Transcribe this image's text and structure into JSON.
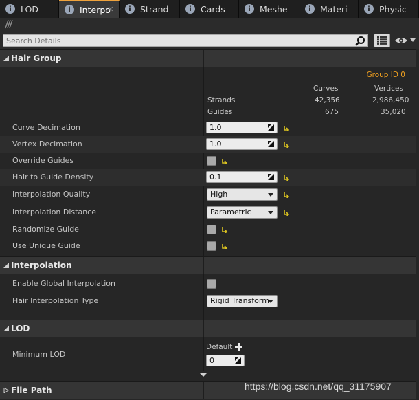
{
  "tabs": [
    {
      "label": "LOD",
      "active": false
    },
    {
      "label": "Interpo",
      "active": true
    },
    {
      "label": "Strand",
      "active": false
    },
    {
      "label": "Cards",
      "active": false
    },
    {
      "label": "Meshe",
      "active": false
    },
    {
      "label": "Materi",
      "active": false
    },
    {
      "label": "Physic",
      "active": false
    }
  ],
  "search": {
    "placeholder": "Search Details"
  },
  "hair_group": {
    "title": "Hair Group",
    "group_id": "Group ID 0",
    "col_curves": "Curves",
    "col_vertices": "Vertices",
    "rows": [
      {
        "label": "Strands",
        "curves": "42,356",
        "vertices": "2,986,450"
      },
      {
        "label": "Guides",
        "curves": "675",
        "vertices": "35,020"
      }
    ],
    "props": {
      "curve_decimation": {
        "label": "Curve Decimation",
        "value": "1.0"
      },
      "vertex_decimation": {
        "label": "Vertex Decimation",
        "value": "1.0"
      },
      "override_guides": {
        "label": "Override Guides",
        "checked": false
      },
      "hair_to_guide_density": {
        "label": "Hair to Guide Density",
        "value": "0.1"
      },
      "interpolation_quality": {
        "label": "Interpolation Quality",
        "value": "High"
      },
      "interpolation_distance": {
        "label": "Interpolation Distance",
        "value": "Parametric"
      },
      "randomize_guide": {
        "label": "Randomize Guide",
        "checked": false
      },
      "use_unique_guide": {
        "label": "Use Unique Guide",
        "checked": false
      }
    }
  },
  "interpolation": {
    "title": "Interpolation",
    "enable_global": {
      "label": "Enable Global Interpolation",
      "checked": false
    },
    "hair_interp_type": {
      "label": "Hair Interpolation Type",
      "value": "Rigid Transform"
    }
  },
  "lod": {
    "title": "LOD",
    "minimum_lod": {
      "label": "Minimum LOD",
      "default_label": "Default",
      "value": "0"
    }
  },
  "file_path": {
    "title": "File Path"
  },
  "watermark": "https://blog.csdn.net/qq_31175907",
  "colors": {
    "accent": "#f0a33c",
    "group_id": "#f0a020",
    "reset_arrow": "#d8c020"
  }
}
